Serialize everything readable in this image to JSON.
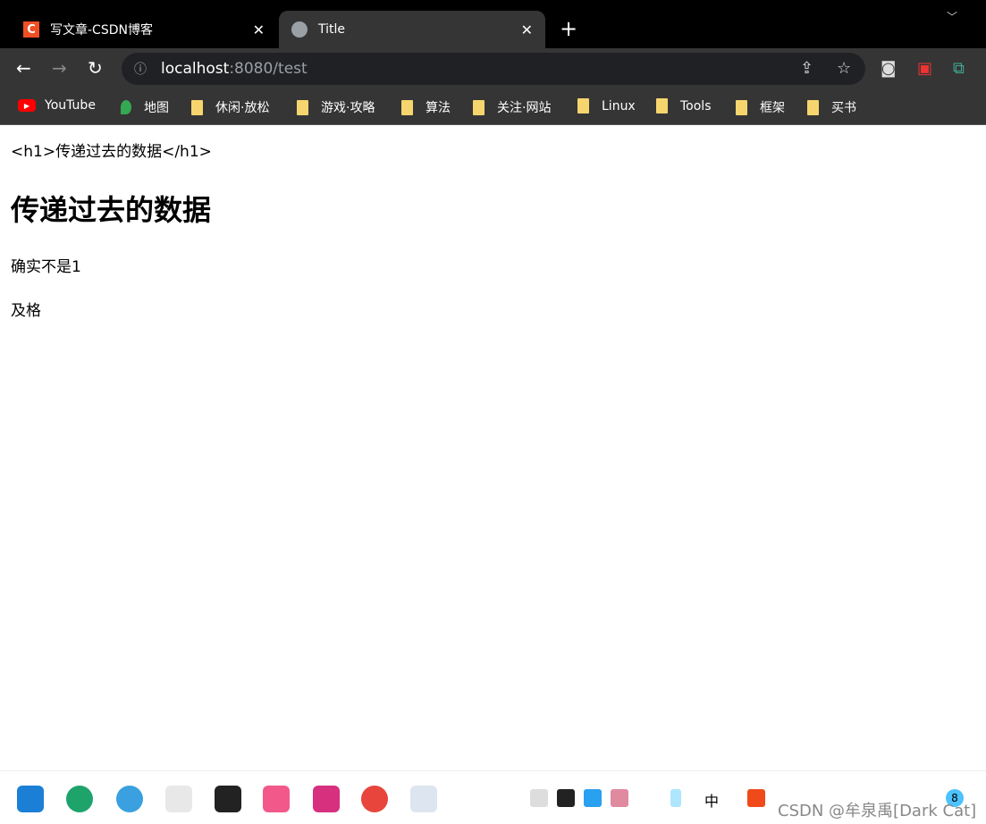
{
  "tabs": [
    {
      "label": "写文章-CSDN博客",
      "icon": "csdn-icon"
    },
    {
      "label": "Title",
      "icon": "globe-icon",
      "active": true
    }
  ],
  "address": {
    "host": "localhost",
    "rest": ":8080/test"
  },
  "bookmarks": [
    "YouTube",
    "地图",
    "休闲·放松",
    "游戏·攻略",
    "算法",
    "关注·网站",
    "Linux",
    "Tools",
    "框架",
    "买书"
  ],
  "page": {
    "raw": "<h1>传递过去的数据</h1>",
    "heading": "传递过去的数据",
    "line1": "确实不是1",
    "line2": "及格"
  },
  "taskbar": {
    "watermark": "CSDN @牟泉禹[Dark Cat]",
    "badge": "8",
    "ime": "中"
  }
}
